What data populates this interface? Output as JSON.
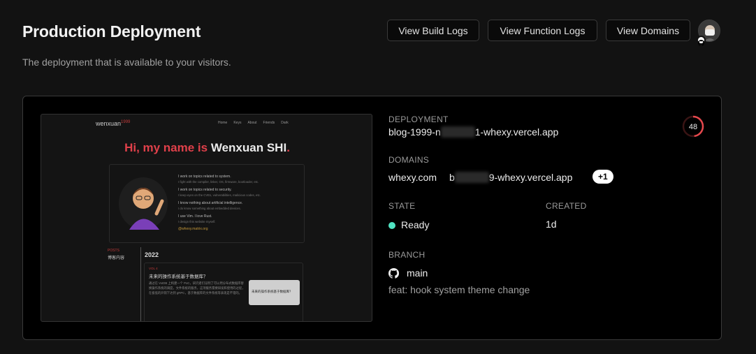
{
  "header": {
    "title": "Production Deployment",
    "subtitle": "The deployment that is available to your visitors.",
    "buttons": {
      "build_logs": "View Build Logs",
      "function_logs": "View Function Logs",
      "domains": "View Domains"
    }
  },
  "deployment": {
    "label": "DEPLOYMENT",
    "url_prefix": "blog-1999-n",
    "url_hidden": "xxxxxxx",
    "url_suffix": "1-whexy.vercel.app",
    "score": "48"
  },
  "domains": {
    "label": "DOMAINS",
    "primary": "whexy.com",
    "secondary_prefix": "b",
    "secondary_hidden": "xxxxxxx",
    "secondary_suffix": "9-whexy.vercel.app",
    "more": "+1"
  },
  "state": {
    "label": "STATE",
    "value": "Ready",
    "status_color": "#50e3c2"
  },
  "created": {
    "label": "CREATED",
    "value": "1d"
  },
  "branch": {
    "label": "BRANCH",
    "name": "main",
    "commit_message": "feat: hook system theme change"
  },
  "preview": {
    "logo": "wenxuan",
    "logo_sup": "1999",
    "nav": [
      "Home",
      "Keys",
      "About",
      "Friends",
      "Dark"
    ],
    "hero_red": "Hi, my name is",
    "hero_white": "Wenxuan SHI",
    "hero_dot": ".",
    "bio": [
      {
        "line": "I work on topics related to system.",
        "sub": "I fight with the compiler, linker, OS, firmware, bootloader, etc."
      },
      {
        "line": "I work on topics related to security.",
        "sub": "I keep eyes on the CVEs, vulnerabilities, malicious codes, etc."
      },
      {
        "line": "I know nothing about artificial intelligence.",
        "sub": "I do know something about embedded devices."
      },
      {
        "line": "I use Vim. I love Rust.",
        "sub": "I design this website myself."
      }
    ],
    "email": "@whexy.matrix.org",
    "posts_label": "POSTS",
    "posts_cn": "博客内容",
    "year": "2022",
    "article_tag": "VOL 4",
    "article_title": "未来的操作系统基于数据库？",
    "article_body": "通过在 VxIDB 上构建一个 PoC，研究者们证明了可以用分布式数据库替换操作系统的调度，文件系统的服务，这项服务需要研发和使用的过程，在极低的开销下达到 gRPC，基于数据库的文件系统等表现是不错的。",
    "article_button": "未来的操作系统基于数据库？"
  }
}
